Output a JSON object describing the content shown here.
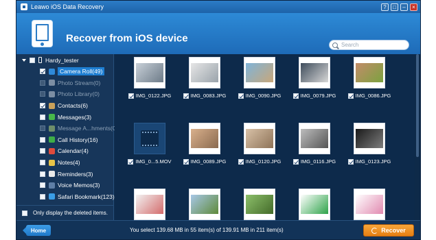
{
  "app": {
    "title": "Leawo iOS Data Recovery",
    "controls": [
      "?",
      "□",
      "–",
      "×"
    ]
  },
  "header": {
    "title": "Recover from iOS device",
    "search_placeholder": "Search"
  },
  "sidebar": {
    "device": "Hardy_tester",
    "items": [
      {
        "label": "Camera Roll(49)",
        "checked": true,
        "dim": false,
        "selected": true,
        "icon": "camera-roll-icon",
        "color": "#2f8ad9"
      },
      {
        "label": "Photo Stream(0)",
        "checked": false,
        "dim": true,
        "selected": false,
        "icon": "photo-stream-icon",
        "color": "#7c8ea3"
      },
      {
        "label": "Photo Library(0)",
        "checked": false,
        "dim": true,
        "selected": false,
        "icon": "photo-library-icon",
        "color": "#7c8ea3"
      },
      {
        "label": "Contacts(6)",
        "checked": true,
        "dim": false,
        "selected": false,
        "icon": "contacts-icon",
        "color": "#c9a15a"
      },
      {
        "label": "Messages(3)",
        "checked": false,
        "dim": false,
        "selected": false,
        "icon": "messages-icon",
        "color": "#47b84a"
      },
      {
        "label": "Message A...hments(0)",
        "checked": false,
        "dim": true,
        "selected": false,
        "icon": "message-attachments-icon",
        "color": "#6e8e6a"
      },
      {
        "label": "Call History(16)",
        "checked": false,
        "dim": false,
        "selected": false,
        "icon": "call-history-icon",
        "color": "#3fae47"
      },
      {
        "label": "Calendar(4)",
        "checked": false,
        "dim": false,
        "selected": false,
        "icon": "calendar-icon",
        "color": "#e04b3c"
      },
      {
        "label": "Notes(4)",
        "checked": false,
        "dim": false,
        "selected": false,
        "icon": "notes-icon",
        "color": "#e8c447"
      },
      {
        "label": "Reminders(3)",
        "checked": false,
        "dim": false,
        "selected": false,
        "icon": "reminders-icon",
        "color": "#e9e9e9"
      },
      {
        "label": "Voice Memos(3)",
        "checked": false,
        "dim": false,
        "selected": false,
        "icon": "voice-memos-icon",
        "color": "#5f7fa6"
      },
      {
        "label": "Safari Bookmark(123)",
        "checked": false,
        "dim": false,
        "selected": false,
        "icon": "safari-bookmark-icon",
        "color": "#3a9ee6"
      }
    ],
    "footer_label": "Only display the deleted items."
  },
  "grid": {
    "items": [
      {
        "name": "IMG_0122.JPG",
        "type": "photo",
        "colors": [
          "#c8d0d8",
          "#6d7b88"
        ]
      },
      {
        "name": "IMG_0083.JPG",
        "type": "photo",
        "colors": [
          "#e6e6e6",
          "#9aa3ab"
        ]
      },
      {
        "name": "IMG_0090.JPG",
        "type": "photo",
        "colors": [
          "#7fb4d9",
          "#c8a77a"
        ]
      },
      {
        "name": "IMG_0079.JPG",
        "type": "photo",
        "colors": [
          "#3f4d5c",
          "#d7d7d7"
        ]
      },
      {
        "name": "IMG_0086.JPG",
        "type": "photo",
        "colors": [
          "#c28c6a",
          "#7ba23f"
        ]
      },
      {
        "name": "IMG_0...5.MOV",
        "type": "video",
        "colors": [
          "#1a4675",
          "#0d2a4b"
        ]
      },
      {
        "name": "IMG_0089.JPG",
        "type": "photo",
        "colors": [
          "#d9b08c",
          "#8a6a4f"
        ]
      },
      {
        "name": "IMG_0120.JPG",
        "type": "photo",
        "colors": [
          "#d8c1a7",
          "#8e7358"
        ]
      },
      {
        "name": "IMG_0116.JPG",
        "type": "photo",
        "colors": [
          "#bdbdbd",
          "#555555"
        ]
      },
      {
        "name": "IMG_0123.JPG",
        "type": "photo",
        "colors": [
          "#1a1a1a",
          "#7d7d7d"
        ]
      },
      {
        "name": "",
        "type": "photo",
        "colors": [
          "#f2f2f2",
          "#d46c6c"
        ]
      },
      {
        "name": "",
        "type": "photo",
        "colors": [
          "#a7c7e7",
          "#5f8a3a"
        ]
      },
      {
        "name": "",
        "type": "photo",
        "colors": [
          "#8cbf6a",
          "#446b2a"
        ]
      },
      {
        "name": "",
        "type": "photo",
        "colors": [
          "#ffffff",
          "#2ea34a"
        ]
      },
      {
        "name": "",
        "type": "photo",
        "colors": [
          "#ffffff",
          "#e18ab0"
        ]
      }
    ]
  },
  "status": {
    "home_label": "Home",
    "text": "You select 139.68 MB in 55 item(s) of 139.91 MB in 211 item(s)",
    "recover_label": "Recover"
  }
}
